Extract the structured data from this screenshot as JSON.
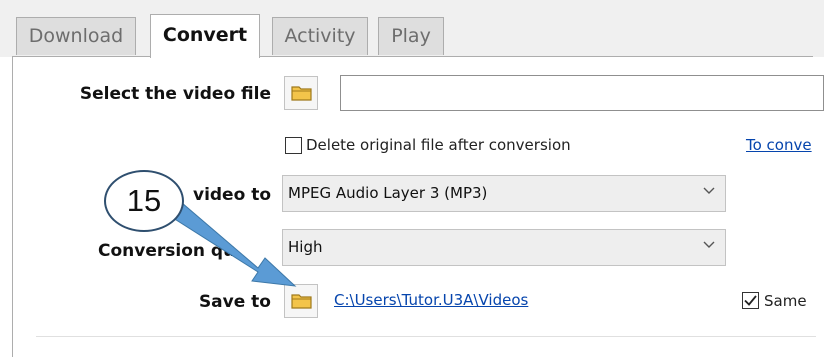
{
  "tabs": [
    {
      "label": "Download",
      "active": false
    },
    {
      "label": "Convert",
      "active": true
    },
    {
      "label": "Activity",
      "active": false
    },
    {
      "label": "Play",
      "active": false
    }
  ],
  "select_file": {
    "label": "Select the video file",
    "value": "",
    "icon": "folder-icon"
  },
  "delete_original": {
    "label": "Delete original file after conversion",
    "checked": false
  },
  "link_partial": "To conve",
  "convert_to": {
    "label": "video to",
    "value": "MPEG Audio Layer 3 (MP3)"
  },
  "conversion_quality": {
    "label": "Conversion qu",
    "value": "High"
  },
  "save_to": {
    "label": "Save to",
    "path": "C:\\Users\\Tutor.U3A\\Videos",
    "icon": "folder-icon"
  },
  "same_checkbox": {
    "label": "Same",
    "checked": true
  },
  "callout": {
    "number": "15",
    "arrow_color": "#5b9bd5"
  },
  "colors": {
    "link": "#0645ad",
    "folder": "#f3c44a",
    "arrow": "#5b9bd5"
  }
}
